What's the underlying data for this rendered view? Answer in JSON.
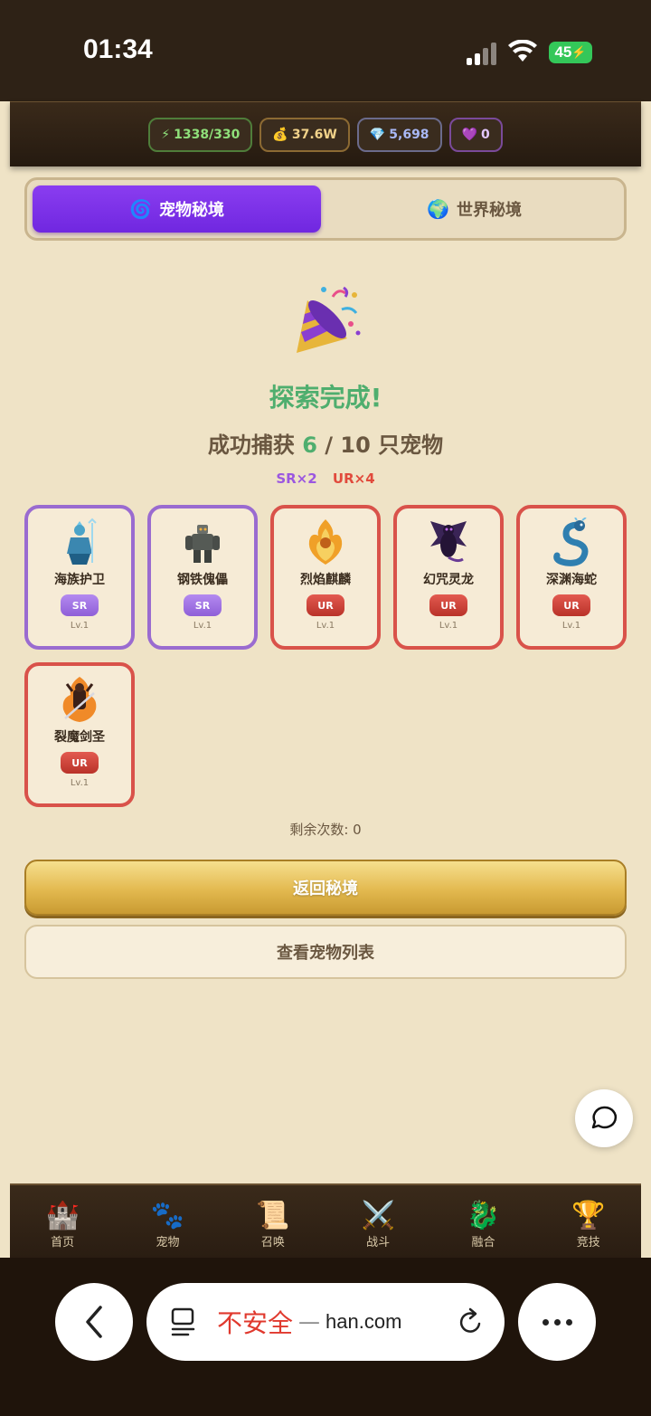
{
  "status_bar": {
    "time": "01:34",
    "battery": "45"
  },
  "resources": {
    "energy": "1338/330",
    "gold": "37.6W",
    "gems": "5,698",
    "hearts": "0"
  },
  "tabs": [
    {
      "label": "宠物秘境",
      "icon": "swirl-icon",
      "active": true
    },
    {
      "label": "世界秘境",
      "icon": "globe-icon",
      "active": false
    }
  ],
  "result": {
    "icon": "party-popper-icon",
    "title": "探索完成!",
    "summary_prefix": "成功捕获",
    "caught": "6",
    "summary_sep": "/",
    "total": "10",
    "summary_suffix": "只宠物",
    "sr_count": "SR×2",
    "ur_count": "UR×4"
  },
  "pets": [
    {
      "name": "海族护卫",
      "rarity": "SR",
      "level": "Lv.1",
      "icon": "sea-guardian-icon"
    },
    {
      "name": "钢铁傀儡",
      "rarity": "SR",
      "level": "Lv.1",
      "icon": "iron-golem-icon"
    },
    {
      "name": "烈焰麒麟",
      "rarity": "UR",
      "level": "Lv.1",
      "icon": "flame-qilin-icon"
    },
    {
      "name": "幻咒灵龙",
      "rarity": "UR",
      "level": "Lv.1",
      "icon": "phantom-dragon-icon"
    },
    {
      "name": "深渊海蛇",
      "rarity": "UR",
      "level": "Lv.1",
      "icon": "abyss-serpent-icon"
    },
    {
      "name": "裂魔剑圣",
      "rarity": "UR",
      "level": "Lv.1",
      "icon": "demon-swordsman-icon"
    }
  ],
  "remaining": "剩余次数: 0",
  "buttons": {
    "back_label": "返回秘境",
    "list_label": "查看宠物列表"
  },
  "nav": [
    {
      "label": "首页",
      "icon": "castle-icon"
    },
    {
      "label": "宠物",
      "icon": "paw-icon"
    },
    {
      "label": "召唤",
      "icon": "scroll-icon"
    },
    {
      "label": "战斗",
      "icon": "crossed-swords-icon"
    },
    {
      "label": "融合",
      "icon": "dragon-icon"
    },
    {
      "label": "竞技",
      "icon": "trophy-icon"
    }
  ],
  "browser": {
    "insecure_label": "不安全",
    "dash": "—",
    "domain": "han.com"
  },
  "colors": {
    "accent_purple": "#7a2fe8",
    "success_green": "#4fae6e",
    "sr_purple": "#9a6bd0",
    "ur_red": "#d9524a",
    "gold_button": "#e3b94f"
  }
}
